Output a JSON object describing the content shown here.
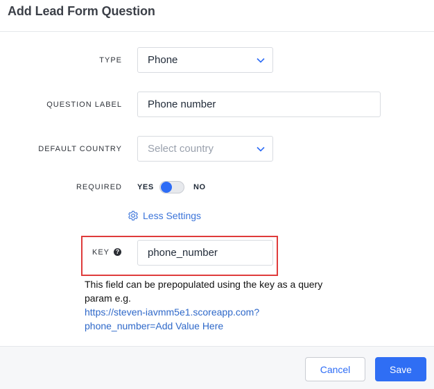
{
  "dialog": {
    "title": "Add Lead Form Question",
    "type": {
      "label": "TYPE",
      "value": "Phone"
    },
    "question_label": {
      "label": "QUESTION LABEL",
      "value": "Phone number"
    },
    "default_country": {
      "label": "DEFAULT COUNTRY",
      "placeholder": "Select country"
    },
    "required": {
      "label": "REQUIRED",
      "yes": "YES",
      "no": "NO",
      "state": "yes"
    },
    "less_settings": "Less Settings",
    "key": {
      "label": "KEY",
      "help_icon": "?",
      "value": "phone_number"
    },
    "help_text": "This field can be prepopulated using the key as a query param e.g.",
    "example_link": "https://steven-iavmm5e1.scoreapp.com?phone_number=Add Value Here",
    "example_link_line1": "https://steven-iavmm5e1.scoreapp.com?",
    "example_link_line2": "phone_number=Add Value Here"
  },
  "footer": {
    "cancel": "Cancel",
    "save": "Save"
  },
  "colors": {
    "accent": "#2d6cf6",
    "highlight": "#df3b3b"
  }
}
